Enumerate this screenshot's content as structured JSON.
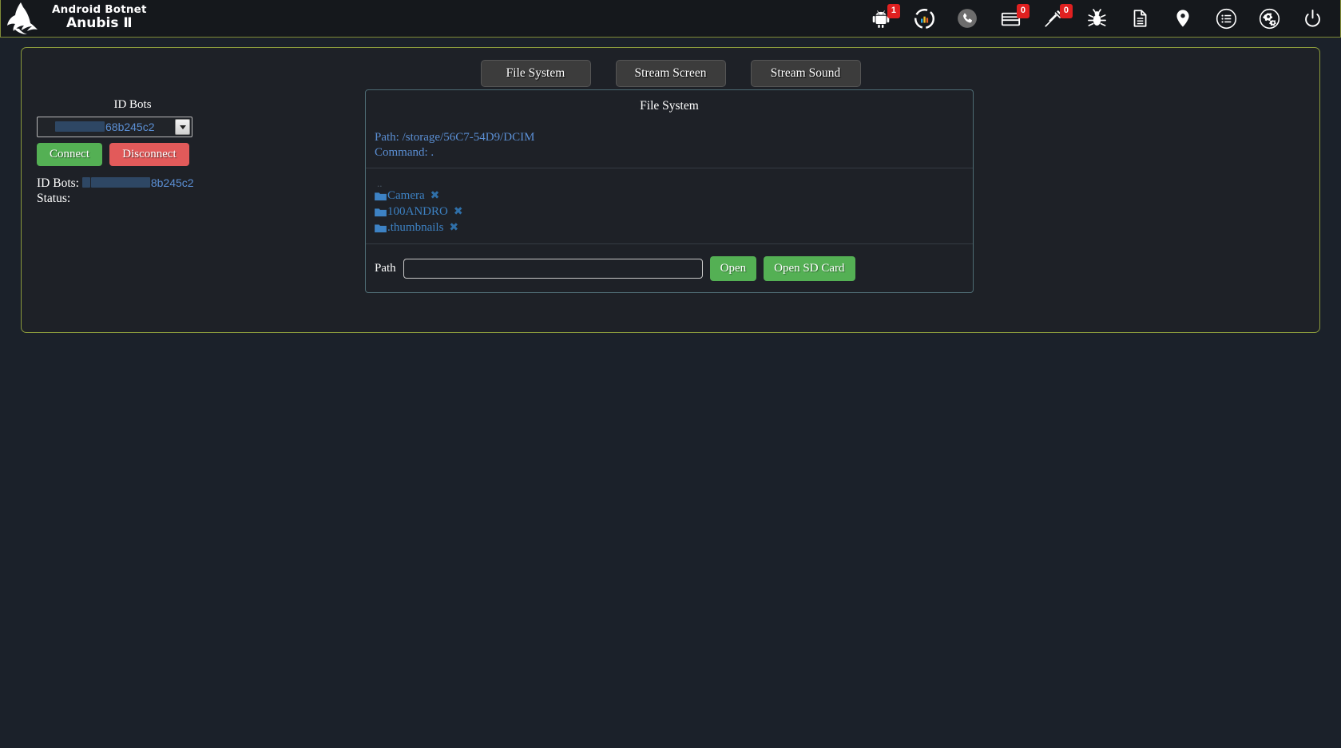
{
  "header": {
    "brand_line1": "Android Botnet",
    "brand_line2": "Anubis Ⅱ",
    "icons": [
      {
        "name": "android-icon",
        "badge": "1"
      },
      {
        "name": "chart-donut-icon",
        "badge": null
      },
      {
        "name": "phone-icon",
        "badge": null
      },
      {
        "name": "credit-card-icon",
        "badge": "0"
      },
      {
        "name": "syringe-icon",
        "badge": "0"
      },
      {
        "name": "bug-icon",
        "badge": null
      },
      {
        "name": "document-icon",
        "badge": null
      },
      {
        "name": "location-pin-icon",
        "badge": null
      },
      {
        "name": "list-circle-icon",
        "badge": null
      },
      {
        "name": "gears-circle-icon",
        "badge": null
      },
      {
        "name": "power-icon",
        "badge": null
      }
    ]
  },
  "tabs": [
    {
      "label": "File System"
    },
    {
      "label": "Stream Screen"
    },
    {
      "label": "Stream Sound"
    }
  ],
  "sidebar": {
    "title": "ID Bots",
    "selected_bot": "68b245c2",
    "connect_label": "Connect",
    "disconnect_label": "Disconnect",
    "id_bots_label": "ID Bots:",
    "id_bots_value": "8b245c2",
    "status_label": "Status:",
    "status_value": ""
  },
  "filesystem": {
    "title": "File System",
    "path_label": "Path: /storage/56C7-54D9/DCIM",
    "command_label": "Command: .",
    "parent_entry": "..",
    "entries": [
      {
        "name": "Camera",
        "delete": "✖"
      },
      {
        "name": "100ANDRO",
        "delete": "✖"
      },
      {
        "name": ".thumbnails",
        "delete": "✖"
      }
    ],
    "path_field_label": "Path",
    "path_field_value": "",
    "path_field_placeholder": "",
    "open_label": "Open",
    "open_sd_label": "Open SD Card"
  },
  "colors": {
    "accent_border": "#8a9a3c",
    "panel_border": "#4e6b73",
    "link": "#3d82c4",
    "green": "#54b054",
    "red": "#e25a5a",
    "badge": "#e02020"
  }
}
